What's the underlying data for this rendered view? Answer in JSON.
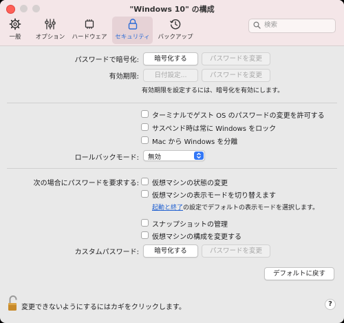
{
  "window": {
    "title": "\"Windows 10\" の構成"
  },
  "toolbar": {
    "tabs": [
      {
        "label": "一般",
        "icon": "gear-icon"
      },
      {
        "label": "オプション",
        "icon": "sliders-icon"
      },
      {
        "label": "ハードウェア",
        "icon": "chip-icon"
      },
      {
        "label": "セキュリティ",
        "icon": "lock-icon",
        "active": true
      },
      {
        "label": "バックアップ",
        "icon": "clock-icon"
      }
    ],
    "search_placeholder": "検索"
  },
  "encryption": {
    "label": "パスワードで暗号化:",
    "encrypt_button": "暗号化する",
    "change_password_button": "パスワードを変更"
  },
  "expiration": {
    "label": "有効期限:",
    "date_button": "日付設定...",
    "change_password_button": "パスワードを変更",
    "note": "有効期限を設定するには、暗号化を有効にします。"
  },
  "options": {
    "allow_terminal": "ターミナルでゲスト OS のパスワードの変更を許可する",
    "lock_on_suspend": "サスペンド時は常に Windows をロック",
    "isolate": "Mac から Windows を分離"
  },
  "rollback": {
    "label": "ロールバックモード:",
    "value": "無効"
  },
  "require_password": {
    "label": "次の場合にパスワードを要求する:",
    "state_change": "仮想マシンの状態の変更",
    "view_mode": "仮想マシンの表示モードを切り替えます",
    "note_link": "起動と終了",
    "note_rest": "の設定でデフォルトの表示モードを選択します。",
    "snapshots": "スナップショットの管理",
    "config_change": "仮想マシンの構成を変更する"
  },
  "custom_password": {
    "label": "カスタムパスワード:",
    "encrypt_button": "暗号化する",
    "change_password_button": "パスワードを変更"
  },
  "defaults_button": "デフォルトに戻す",
  "footer": {
    "lock_text": "変更できないようにするにはカギをクリックします。",
    "help": "?"
  },
  "colors": {
    "accent": "#3478f6",
    "close": "#fe5f57",
    "titlebar": "#f4e6e8",
    "lock": "#c88a2a"
  }
}
